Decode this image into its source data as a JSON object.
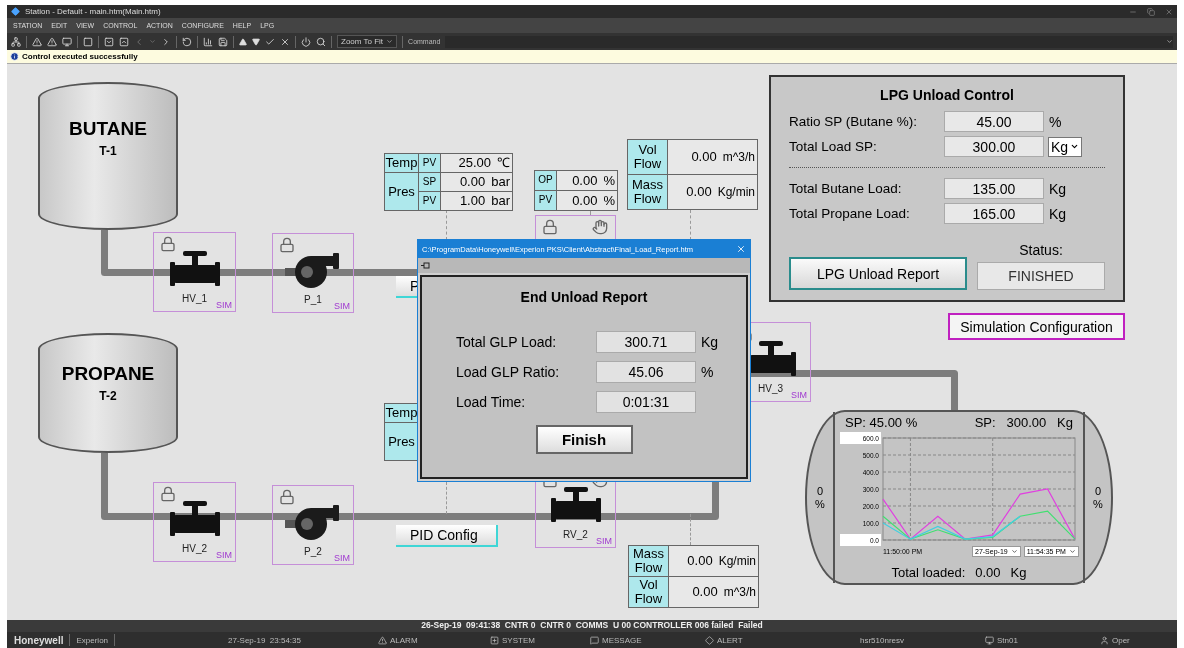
{
  "window": {
    "title": "Station - Default - main.htm(Main.htm)"
  },
  "menu": [
    "STATION",
    "EDIT",
    "VIEW",
    "CONTROL",
    "ACTION",
    "CONFIGURE",
    "HELP",
    "LPG"
  ],
  "toolbar": {
    "zoom": "Zoom To Fit",
    "command_label": "Command"
  },
  "message": "Control executed successfully",
  "tanks": [
    {
      "name": "BUTANE",
      "tag": "T-1"
    },
    {
      "name": "PROPANE",
      "tag": "T-2"
    }
  ],
  "equipment": [
    {
      "kind": "valve",
      "tag": "HV_1",
      "mode": "SIM"
    },
    {
      "kind": "pump",
      "tag": "P_1",
      "mode": "SIM"
    },
    {
      "kind": "valve",
      "tag": "HV_2",
      "mode": "SIM"
    },
    {
      "kind": "pump",
      "tag": "P_2",
      "mode": "SIM"
    },
    {
      "kind": "control_valve",
      "tag": "RV_2",
      "mode": "SIM"
    },
    {
      "kind": "valve",
      "tag": "HV_3",
      "mode": "SIM"
    }
  ],
  "temp_pres_top": [
    {
      "label": "Temp",
      "rows": [
        {
          "param": "PV",
          "value": "25.00",
          "unit": "℃"
        }
      ]
    },
    {
      "label": "Pres",
      "rows": [
        {
          "param": "SP",
          "value": "0.00",
          "unit": "bar"
        },
        {
          "param": "PV",
          "value": "1.00",
          "unit": "bar"
        }
      ]
    }
  ],
  "temp_pres_bottom": [
    {
      "label": "Temp"
    },
    {
      "label": "Pres"
    }
  ],
  "op_pv": [
    {
      "param": "OP",
      "value": "0.00",
      "unit": "%"
    },
    {
      "param": "PV",
      "value": "0.00",
      "unit": "%"
    }
  ],
  "flow_top": [
    {
      "label": "Vol Flow",
      "value": "0.00",
      "unit": "m^3/h"
    },
    {
      "label": "Mass Flow",
      "value": "0.00",
      "unit": "Kg/min"
    }
  ],
  "flow_bottom": [
    {
      "label": "Mass Flow",
      "value": "0.00",
      "unit": "Kg/min"
    },
    {
      "label": "Vol Flow",
      "value": "0.00",
      "unit": "m^3/h"
    }
  ],
  "pid_buttons": [
    "P",
    "PID Config"
  ],
  "lpg_panel": {
    "title": "LPG Unload Control",
    "fields": [
      {
        "kind": "text",
        "label": "Ratio SP (Butane %):",
        "value": "45.00",
        "unit": "%"
      },
      {
        "kind": "select",
        "label": "Total Load SP:",
        "value": "300.00",
        "unit": "Kg"
      },
      {
        "kind": "text",
        "label": "Total Butane Load:",
        "value": "135.00",
        "unit": "Kg"
      },
      {
        "kind": "text",
        "label": "Total Propane Load:",
        "value": "165.00",
        "unit": "Kg"
      }
    ],
    "status_label": "Status:",
    "report_button": "LPG Unload Report",
    "status": "FINISHED"
  },
  "sim_button": "Simulation Configuration",
  "trend": {
    "sp_ratio": "SP: 45.00 %",
    "sp_load": "SP:   300.00   Kg",
    "left_level": "0 %",
    "right_level": "0 %",
    "date": "27-Sep-19",
    "time": "11:54:35 PM",
    "total_label": "Total loaded:",
    "total_value": "0.00",
    "total_unit": "Kg",
    "start_time": "11:50:00 PM",
    "chart_data": {
      "type": "line",
      "grid": true,
      "ylim": [
        0,
        600
      ],
      "yticks": [
        {
          "value": 0,
          "label": "0.0"
        },
        {
          "value": 100,
          "label": "100.0"
        },
        {
          "value": 200,
          "label": "200.0"
        },
        {
          "value": 300,
          "label": "300.0"
        },
        {
          "value": 400,
          "label": "400.0"
        },
        {
          "value": 500,
          "label": "500.0"
        },
        {
          "value": 600,
          "label": "600.0"
        }
      ],
      "series": [
        {
          "color": "#e040e0",
          "values": [
            240,
            5,
            140,
            5,
            30,
            270,
            300,
            5
          ]
        },
        {
          "color": "#40e070",
          "values": [
            140,
            5,
            60,
            5,
            15,
            140,
            170,
            5
          ]
        },
        {
          "color": "#40d0e0",
          "values": [
            100,
            5,
            80,
            5,
            20,
            140,
            null,
            null
          ]
        }
      ]
    }
  },
  "dialog": {
    "title": "C:\\ProgramData\\Honeywell\\Experion PKS\\Client\\Abstract\\Final_Load_Report.htm",
    "heading": "End Unload Report",
    "rows": [
      {
        "label": "Total GLP Load:",
        "value": "300.71",
        "unit": "Kg"
      },
      {
        "label": "Load GLP Ratio:",
        "value": "45.06",
        "unit": "%"
      },
      {
        "label": "Load Time:",
        "value": "0:01:31"
      }
    ],
    "button": "Finish"
  },
  "status_line": "26-Sep-19  09:41:38  CNTR 0  CNTR 0  COMMS  U 00 CONTROLLER 006 failed  Failed",
  "footer": {
    "brand": "Honeywell",
    "product": "Experion",
    "datetime": "27-Sep-19  23:54:35",
    "items": [
      {
        "kind": "alarm",
        "label": "ALARM"
      },
      {
        "kind": "system",
        "label": "SYSTEM"
      },
      {
        "kind": "message",
        "label": "MESSAGE"
      },
      {
        "kind": "alert",
        "label": "ALERT"
      }
    ],
    "host": "hsr510nresv",
    "station": "Stn01",
    "operator": "Oper"
  }
}
